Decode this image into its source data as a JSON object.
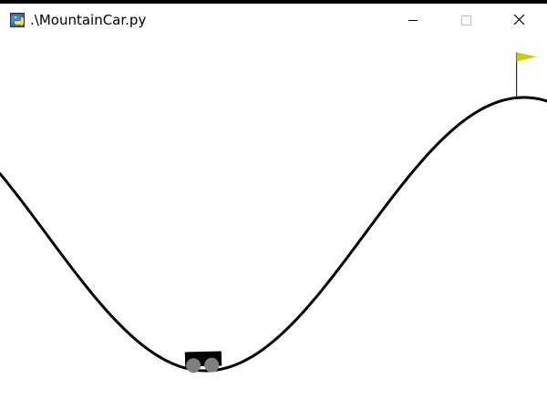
{
  "window": {
    "title": ".\\MountainCar.py"
  },
  "controls": {
    "minimize_icon": "minimize-icon",
    "maximize_icon": "maximize-icon",
    "close_icon": "close-icon"
  },
  "environment": {
    "name": "MountainCar",
    "track_color": "#000000",
    "car_body_color": "#000000",
    "wheel_color": "#7f7f7f",
    "flag_color": "#cccc00",
    "flagpole_color": "#000000",
    "car_position": -0.53,
    "goal_position": 0.5,
    "x_range": [
      -1.2,
      0.6
    ]
  }
}
